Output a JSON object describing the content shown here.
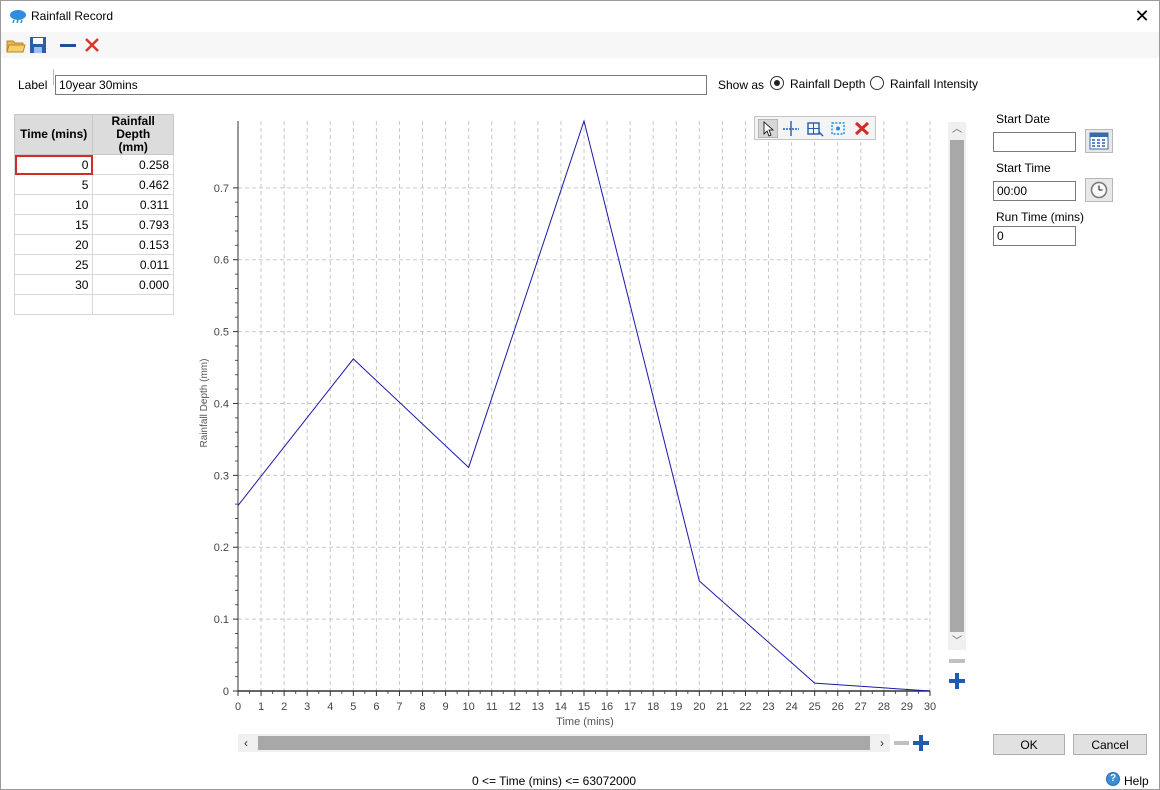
{
  "window": {
    "title": "Rainfall Record",
    "close_glyph": "✕"
  },
  "toolbar": {
    "icons": [
      "open-folder-icon",
      "save-icon",
      "minus-icon",
      "delete-icon"
    ]
  },
  "label_field": {
    "caption": "Label",
    "value": "10year 30mins"
  },
  "show_as": {
    "caption": "Show as",
    "options": [
      {
        "label": "Rainfall Depth",
        "checked": true
      },
      {
        "label": "Rainfall Intensity",
        "checked": false
      }
    ]
  },
  "table": {
    "headers": [
      "Time (mins)",
      "Rainfall Depth\n(mm)"
    ],
    "header_1": "Time (mins)",
    "header_2a": "Rainfall Depth",
    "header_2b": "(mm)",
    "rows": [
      [
        "0",
        "0.258"
      ],
      [
        "5",
        "0.462"
      ],
      [
        "10",
        "0.311"
      ],
      [
        "15",
        "0.793"
      ],
      [
        "20",
        "0.153"
      ],
      [
        "25",
        "0.011"
      ],
      [
        "30",
        "0.000"
      ],
      [
        "",
        ""
      ]
    ]
  },
  "chart_data": {
    "type": "line",
    "x": [
      0,
      5,
      10,
      15,
      20,
      25,
      30
    ],
    "y": [
      0.258,
      0.462,
      0.311,
      0.793,
      0.153,
      0.011,
      0.0
    ],
    "xlabel": "Time (mins)",
    "ylabel": "Rainfall Depth (mm)",
    "xlim": [
      0,
      30
    ],
    "ylim": [
      0,
      0.793
    ],
    "xticks": [
      "0",
      "1",
      "2",
      "3",
      "4",
      "5",
      "6",
      "7",
      "8",
      "9",
      "10",
      "11",
      "12",
      "13",
      "14",
      "15",
      "16",
      "17",
      "18",
      "19",
      "20",
      "21",
      "22",
      "23",
      "24",
      "25",
      "26",
      "27",
      "28",
      "29",
      "30"
    ],
    "yticks": [
      "0",
      "0.1",
      "0.2",
      "0.3",
      "0.4",
      "0.5",
      "0.6",
      "0.7"
    ],
    "line_color": "#1a1aa8",
    "grid": true
  },
  "chart_tools": [
    "pointer-icon",
    "crosshair-icon",
    "zoom-box-icon",
    "pan-icon",
    "reset-zoom-icon"
  ],
  "right_panel": {
    "start_date_label": "Start Date",
    "start_date_value": "",
    "start_time_label": "Start Time",
    "start_time_value": "00:00",
    "run_time_label": "Run Time (mins)",
    "run_time_value": "0"
  },
  "buttons": {
    "ok": "OK",
    "cancel": "Cancel"
  },
  "status": {
    "range_text": "0 <= Time (mins) <= 63072000",
    "help": "Help"
  }
}
